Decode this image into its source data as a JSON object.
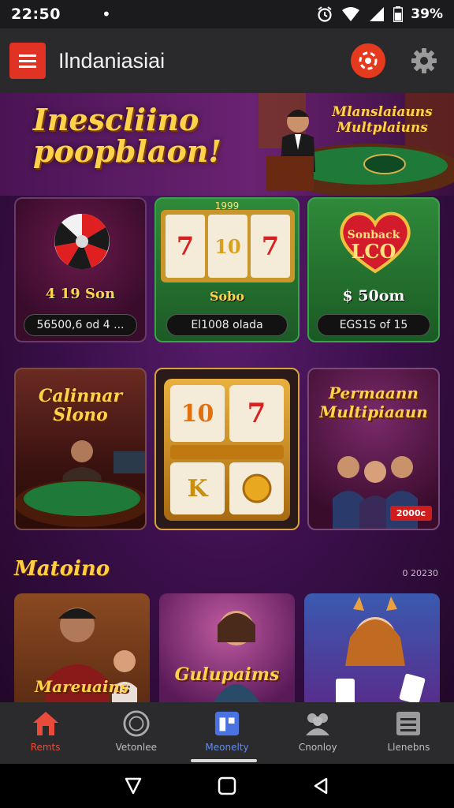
{
  "status_bar": {
    "time": "22:50",
    "dot": "•",
    "battery": "39%"
  },
  "app_bar": {
    "title": "Ilndaniasiai"
  },
  "banner": {
    "title_line1": "Inescliino",
    "title_line2": "poopblaon!",
    "side_title": "Mlanslaiauns Multplaiuns"
  },
  "cards": [
    {
      "value": "4 19 Son",
      "pill": "56500,6 od 4 ..."
    },
    {
      "header": "1999",
      "value": "Sobo",
      "pill": "El1008 olada"
    },
    {
      "badge_line1": "Sonback",
      "badge_line2": "LCO",
      "value": "$ 50om",
      "pill": "EGS1S of 15"
    }
  ],
  "tiles": [
    {
      "title": "Calinnar Slono"
    },
    {
      "reel_a": "10",
      "reel_b": "7",
      "reel_c": "K"
    },
    {
      "title": "Permaann Multipiaaun",
      "chip": "2000c"
    }
  ],
  "section": {
    "title": "Matoino",
    "aux": "0 20230"
  },
  "games": [
    {
      "title": "Mareuains"
    },
    {
      "title": "Gulupaims"
    },
    {
      "title": ""
    }
  ],
  "bottom_nav": {
    "items": [
      {
        "label": "Remts",
        "icon": "home-icon"
      },
      {
        "label": "Vetonlee",
        "icon": "chip-icon"
      },
      {
        "label": "Meonelty",
        "icon": "news-icon"
      },
      {
        "label": "Cnonloy",
        "icon": "group-icon"
      },
      {
        "label": "Llenebns",
        "icon": "list-icon"
      }
    ]
  },
  "colors": {
    "accent_red": "#e13324",
    "gold": "#ffd24a",
    "active_blue": "#5f8cf0"
  }
}
